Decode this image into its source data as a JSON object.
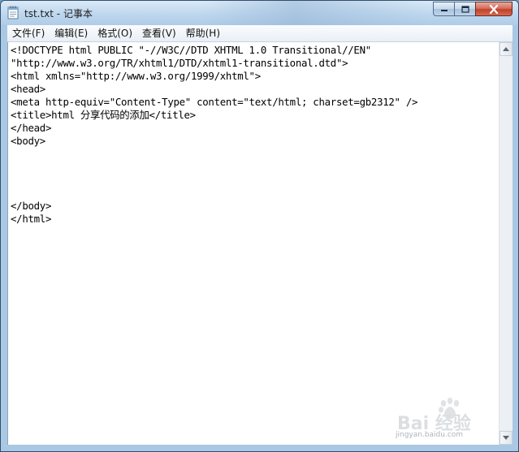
{
  "window": {
    "title": "tst.txt - 记事本",
    "controls": {
      "minimize": "minimize",
      "maximize": "maximize",
      "close": "close"
    }
  },
  "menu": {
    "items": [
      "文件(F)",
      "编辑(E)",
      "格式(O)",
      "查看(V)",
      "帮助(H)"
    ]
  },
  "editor": {
    "lines": [
      "<!DOCTYPE html PUBLIC \"-//W3C//DTD XHTML 1.0 Transitional//EN\"",
      "\"http://www.w3.org/TR/xhtml1/DTD/xhtml1-transitional.dtd\">",
      "<html xmlns=\"http://www.w3.org/1999/xhtml\">",
      "<head>",
      "<meta http-equiv=\"Content-Type\" content=\"text/html; charset=gb2312\" />",
      "<title>html 分享代码的添加</title>",
      "</head>",
      "<body>",
      "",
      "",
      "",
      "",
      "</body>",
      "</html>"
    ]
  },
  "watermark": {
    "logo_text": "Bai 经验",
    "url": "jingyan.baidu.com"
  },
  "icons": {
    "app": "notepad-icon",
    "scroll_up": "arrow-up-icon",
    "scroll_down": "arrow-down-icon"
  }
}
